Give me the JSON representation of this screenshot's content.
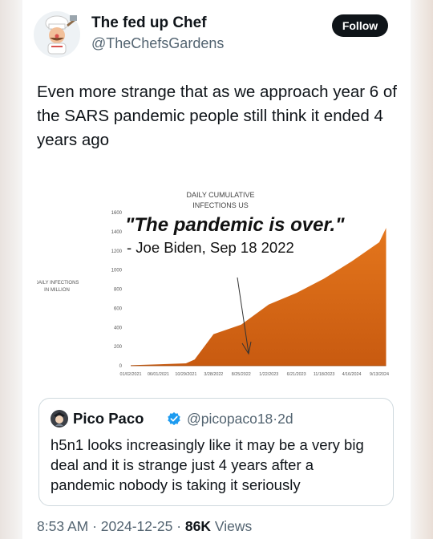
{
  "author": {
    "name": "The fed up Chef",
    "handle": "@TheChefsGardens",
    "follow_label": "Follow"
  },
  "tweet": {
    "text": "Even more strange that as we approach year 6 of the SARS pandemic people still think it ended 4 years ago"
  },
  "media": {
    "quote_line": "\"The pandemic is over.\"",
    "attribution": "- Joe Biden, Sep 18 2022",
    "chart_data": {
      "type": "area",
      "title": "DAILY CUMULATIVE INFECTIONS US",
      "ylabel": "DAILY INFECTIONS IN MILLION",
      "xlabel": "",
      "ylim": [
        0,
        1600
      ],
      "yticks": [
        0,
        200,
        400,
        600,
        800,
        1000,
        1200,
        1400,
        1600
      ],
      "xtick_labels": [
        "01/02/2021",
        "06/01/2021",
        "10/29/2021",
        "3/28/2022",
        "8/25/2022",
        "1/22/2023",
        "6/21/2023",
        "11/18/2023",
        "4/16/2024",
        "9/13/2024"
      ],
      "x": [
        "01/02/2021",
        "06/01/2021",
        "10/29/2021",
        "12/15/2021",
        "3/28/2022",
        "8/25/2022",
        "1/22/2023",
        "6/21/2023",
        "11/18/2023",
        "4/16/2024",
        "9/13/2024",
        "10/20/2024"
      ],
      "series": [
        {
          "values": [
            5,
            15,
            25,
            65,
            330,
            430,
            640,
            760,
            910,
            1090,
            1290,
            1440
          ]
        }
      ],
      "color": "#e4761c",
      "grid": false
    }
  },
  "quoted": {
    "name": "Pico Paco",
    "handle": "@picopaco18",
    "separator": "·",
    "time": "2d",
    "text": "h5n1 looks increasingly like it may be a very big deal and it is strange just 4 years after a pandemic nobody is taking it seriously"
  },
  "meta": {
    "time": "8:53 AM",
    "dot1": "·",
    "date": "2024-12-25",
    "dot2": "·",
    "views_count": "86K",
    "views_label": "Views"
  },
  "colors": {
    "accent": "#1d9bf0",
    "chart_orange": "#e4761c",
    "text_secondary": "#536471"
  }
}
